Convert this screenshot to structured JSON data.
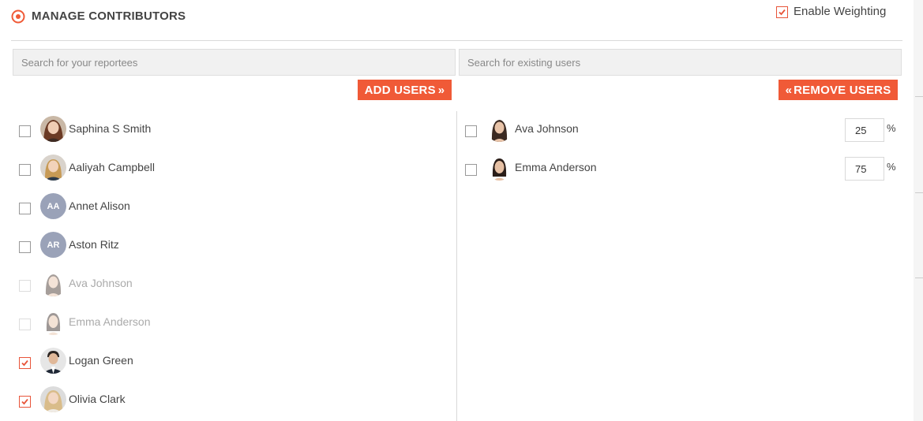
{
  "header": {
    "title": "MANAGE CONTRIBUTORS",
    "title_icon": "target-icon",
    "enable_weighting": {
      "label": "Enable Weighting",
      "checked": true
    }
  },
  "search": {
    "reportees_placeholder": "Search for your reportees",
    "existing_placeholder": "Search for existing users"
  },
  "buttons": {
    "add_label": "ADD USERS",
    "add_icon": "»",
    "remove_label": "REMOVE USERS",
    "remove_icon": "«"
  },
  "reportees": [
    {
      "name": "Saphina S Smith",
      "checked": false,
      "disabled": false,
      "avatar": "photo"
    },
    {
      "name": "Aaliyah Campbell",
      "checked": false,
      "disabled": false,
      "avatar": "photo"
    },
    {
      "name": "Annet Alison",
      "checked": false,
      "disabled": false,
      "avatar": "initials",
      "initials": "AA"
    },
    {
      "name": "Aston Ritz",
      "checked": false,
      "disabled": false,
      "avatar": "initials",
      "initials": "AR"
    },
    {
      "name": "Ava Johnson",
      "checked": false,
      "disabled": true,
      "avatar": "photo"
    },
    {
      "name": "Emma Anderson",
      "checked": false,
      "disabled": true,
      "avatar": "photo"
    },
    {
      "name": "Logan Green",
      "checked": true,
      "disabled": false,
      "avatar": "photo"
    },
    {
      "name": "Olivia Clark",
      "checked": true,
      "disabled": false,
      "avatar": "photo"
    }
  ],
  "existing_users": [
    {
      "name": "Ava Johnson",
      "checked": false,
      "weight": "25",
      "unit": "%"
    },
    {
      "name": "Emma Anderson",
      "checked": false,
      "weight": "75",
      "unit": "%"
    }
  ],
  "colors": {
    "accent": "#f05a37",
    "avatar_initials_bg": "#9aa2b8"
  }
}
